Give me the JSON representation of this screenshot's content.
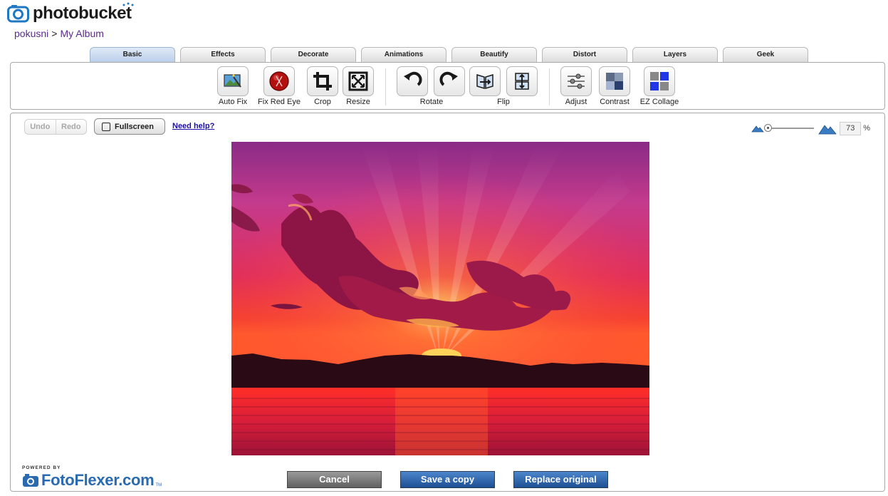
{
  "brand": {
    "logo_text": "photobucket",
    "logo_part1": "photo",
    "logo_part2": "bucket"
  },
  "breadcrumb": {
    "user": "pokusni",
    "separator": ">",
    "album": "My Album"
  },
  "tabs": [
    {
      "label": "Basic",
      "active": true
    },
    {
      "label": "Effects"
    },
    {
      "label": "Decorate"
    },
    {
      "label": "Animations"
    },
    {
      "label": "Beautify"
    },
    {
      "label": "Distort"
    },
    {
      "label": "Layers"
    },
    {
      "label": "Geek"
    }
  ],
  "tools": {
    "auto_fix": "Auto Fix",
    "red_eye": "Fix Red Eye",
    "crop": "Crop",
    "resize": "Resize",
    "rotate": "Rotate",
    "flip": "Flip",
    "adjust": "Adjust",
    "contrast": "Contrast",
    "collage": "EZ Collage"
  },
  "editor": {
    "undo": "Undo",
    "redo": "Redo",
    "fullscreen": "Fullscreen",
    "help": "Need help?",
    "zoom_value": "73",
    "zoom_unit": "%",
    "zoom_fraction": 0.0
  },
  "footer": {
    "powered_by": "POWERED BY",
    "fotoflexer": "FotoFlexer.com",
    "tm": "TM",
    "cancel": "Cancel",
    "save_copy": "Save a copy",
    "replace": "Replace original"
  },
  "colors": {
    "accent_blue": "#1d4f93",
    "link": "#1a0dab",
    "breadcrumb": "#5a2a8a",
    "fotoflexer": "#2a6bb0"
  }
}
